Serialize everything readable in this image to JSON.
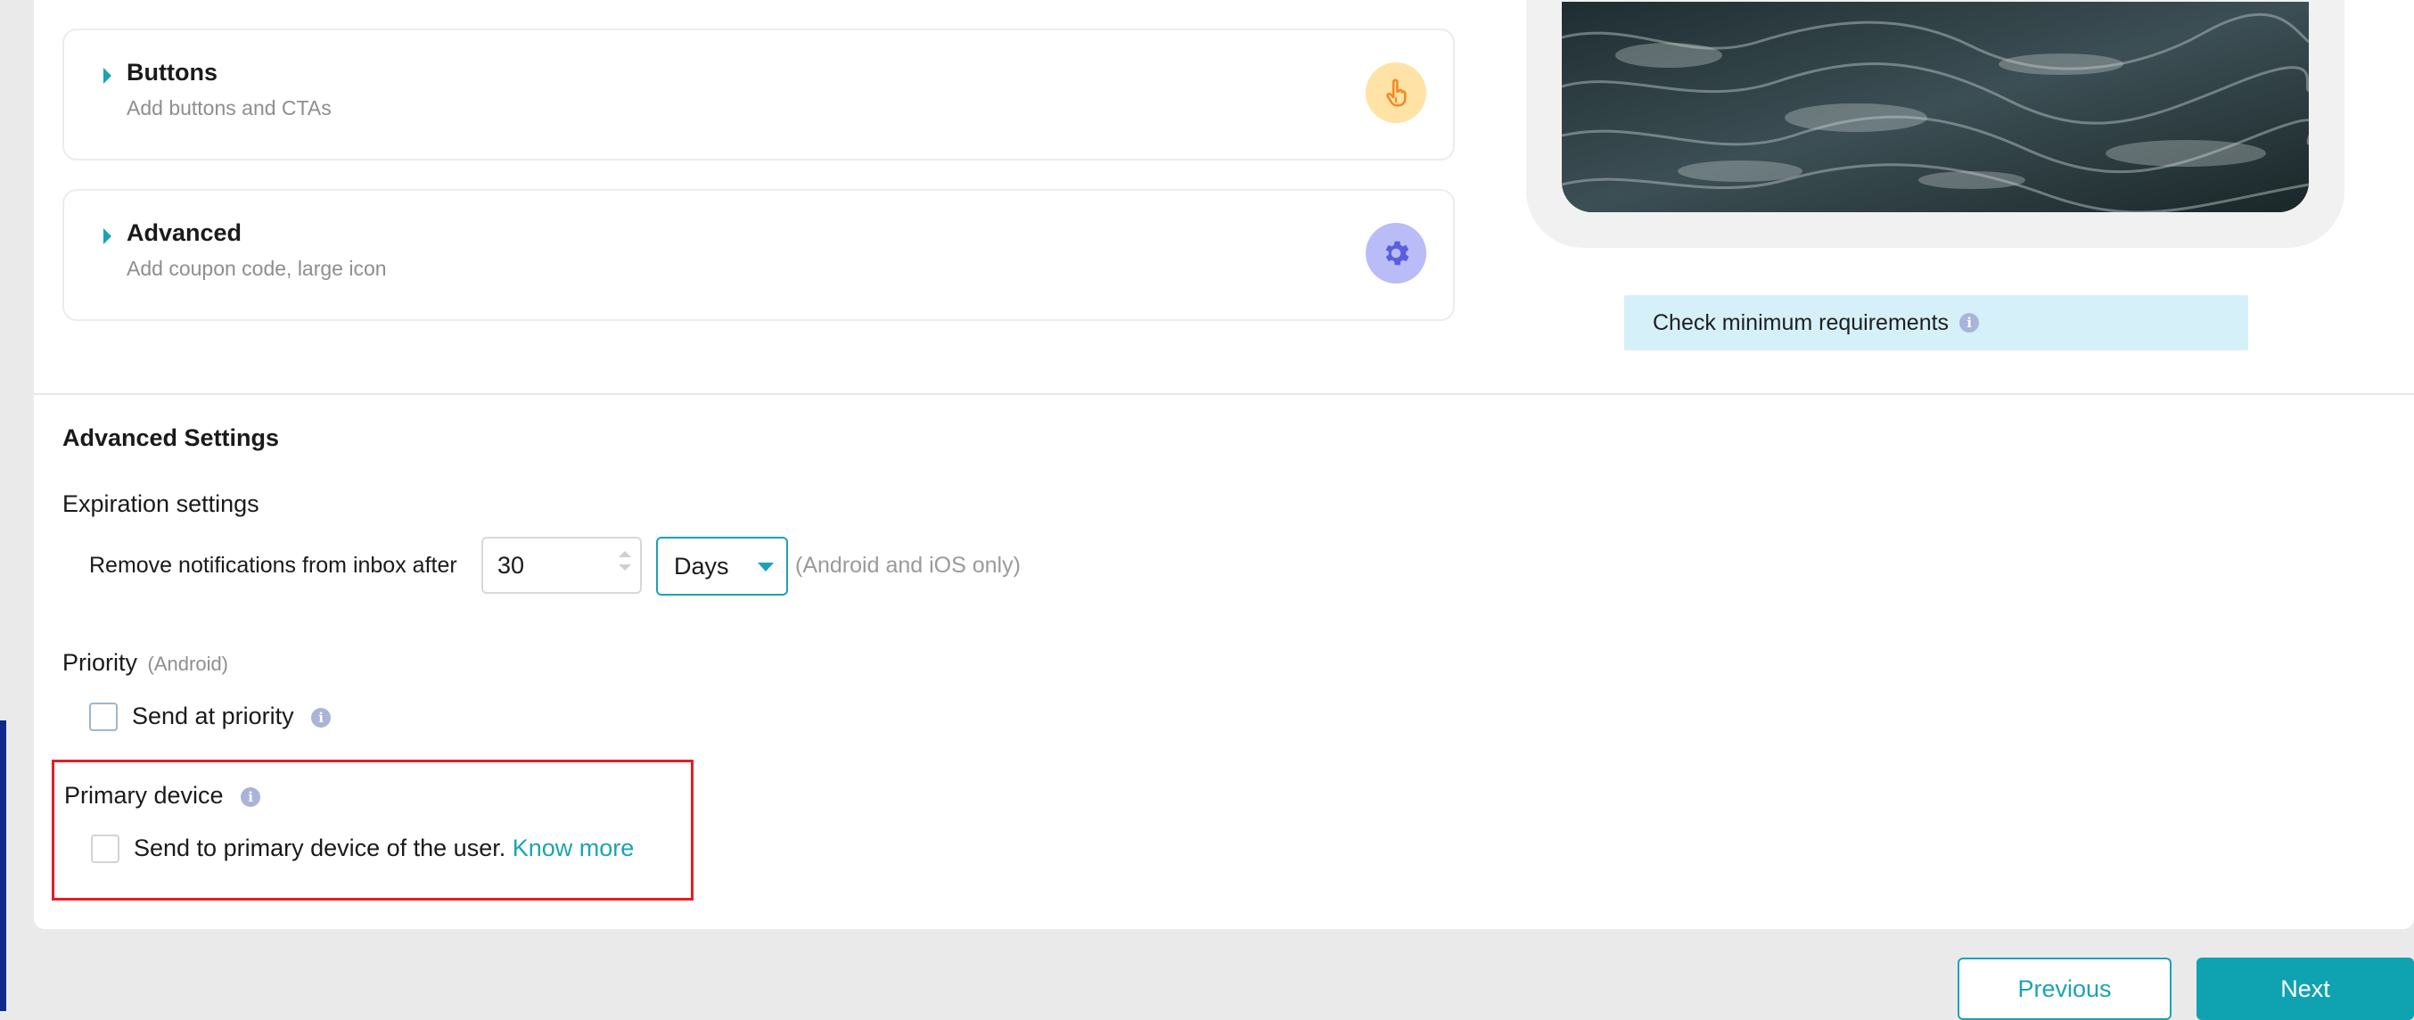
{
  "sections": [
    {
      "title": "Buttons",
      "subtitle": "Add buttons and CTAs",
      "icon": "pointer-hand-icon",
      "icon_bg": "#ffe2a6"
    },
    {
      "title": "Advanced",
      "subtitle": "Add coupon code, large icon",
      "icon": "gear-icon",
      "icon_bg": "#b9bcf6"
    }
  ],
  "preview": {
    "image_desc_icon": "ocean-wave-image",
    "requirements_label": "Check minimum requirements"
  },
  "advanced_settings": {
    "title": "Advanced Settings",
    "expiration": {
      "title": "Expiration settings",
      "remove_label": "Remove notifications from inbox after",
      "value": "30",
      "unit": "Days",
      "platform_note": "(Android and iOS only)"
    },
    "priority": {
      "title": "Priority",
      "platform": "(Android)",
      "checkbox_label": "Send at priority",
      "checked": false
    },
    "primary_device": {
      "title": "Primary device",
      "checkbox_label": "Send to primary device of the user.",
      "link_label": "Know more",
      "checked": false
    }
  },
  "footer": {
    "previous_label": "Previous",
    "next_label": "Next"
  },
  "colors": {
    "accent": "#1ba3b3",
    "highlight": "#e31e24",
    "info": "#a9b4d8"
  }
}
